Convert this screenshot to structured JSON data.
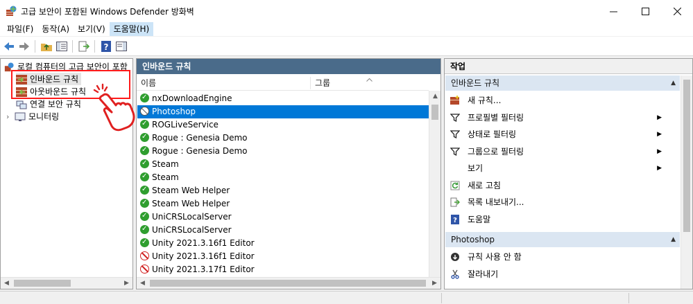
{
  "window": {
    "title": "고급 보안이 포함된 Windows Defender 방화벽",
    "minimize_icon": "minimize-icon",
    "maximize_icon": "maximize-icon",
    "close_icon": "close-icon"
  },
  "menu": [
    {
      "label": "파일(F)"
    },
    {
      "label": "동작(A)"
    },
    {
      "label": "보기(V)"
    },
    {
      "label": "도움말(H)",
      "active": true
    }
  ],
  "toolbar": [
    "back-icon",
    "forward-icon",
    "up-folder-icon",
    "show-hide-console-tree-icon",
    "export-list-icon",
    "help-icon",
    "show-hide-action-pane-icon"
  ],
  "tree": {
    "root": "로컬 컴퓨터의 고급 보안이 포함",
    "items": [
      {
        "label": "인바운드 규칙",
        "icon": "inbound-rules-icon",
        "selected": true
      },
      {
        "label": "아웃바운드 규칙",
        "icon": "outbound-rules-icon"
      },
      {
        "label": "연결 보안 규칙",
        "icon": "connection-security-icon"
      },
      {
        "label": "모니터링",
        "icon": "monitoring-icon",
        "expandable": true
      }
    ]
  },
  "rules_pane": {
    "title": "인바운드 규칙",
    "columns": [
      "이름",
      "그룹"
    ],
    "rows": [
      {
        "name": "nxDownloadEngine",
        "status": "allow"
      },
      {
        "name": "Photoshop",
        "status": "disabled",
        "selected": true
      },
      {
        "name": "ROGLiveService",
        "status": "allow"
      },
      {
        "name": "Rogue : Genesia Demo",
        "status": "allow"
      },
      {
        "name": "Rogue : Genesia Demo",
        "status": "allow"
      },
      {
        "name": "Steam",
        "status": "allow"
      },
      {
        "name": "Steam",
        "status": "allow"
      },
      {
        "name": "Steam Web Helper",
        "status": "allow"
      },
      {
        "name": "Steam Web Helper",
        "status": "allow"
      },
      {
        "name": "UniCRSLocalServer",
        "status": "allow"
      },
      {
        "name": "UniCRSLocalServer",
        "status": "allow"
      },
      {
        "name": "Unity 2021.3.16f1 Editor",
        "status": "allow"
      },
      {
        "name": "Unity 2021.3.16f1 Editor",
        "status": "block"
      },
      {
        "name": "Unity 2021.3.17f1 Editor",
        "status": "block"
      }
    ]
  },
  "actions_pane": {
    "title": "작업",
    "section1": {
      "title": "인바운드 규칙",
      "items": [
        {
          "label": "새 규칙...",
          "icon": "new-rule-icon"
        },
        {
          "label": "프로필별 필터링",
          "icon": "filter-icon",
          "submenu": true
        },
        {
          "label": "상태로 필터링",
          "icon": "filter-icon",
          "submenu": true
        },
        {
          "label": "그룹으로 필터링",
          "icon": "filter-icon",
          "submenu": true
        },
        {
          "label": "보기",
          "icon": "",
          "submenu": true
        },
        {
          "label": "새로 고침",
          "icon": "refresh-icon"
        },
        {
          "label": "목록 내보내기...",
          "icon": "export-list-icon"
        },
        {
          "label": "도움말",
          "icon": "help-icon"
        }
      ]
    },
    "section2": {
      "title": "Photoshop",
      "items": [
        {
          "label": "규칙 사용 안 함",
          "icon": "disable-rule-icon"
        },
        {
          "label": "잘라내기",
          "icon": "cut-icon"
        }
      ]
    }
  },
  "colors": {
    "selection": "#0078d7",
    "header_bar": "#4a6b8a",
    "highlight_box": "#ff1a1a",
    "section_band": "#dbe6f2"
  }
}
